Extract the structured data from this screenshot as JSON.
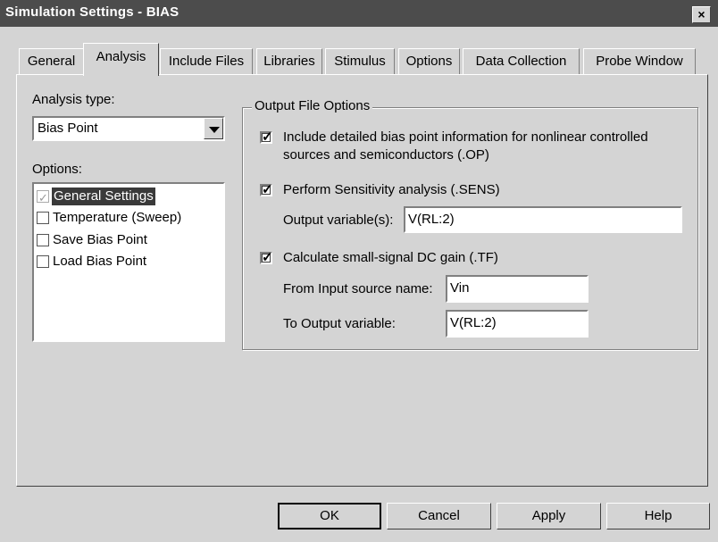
{
  "window": {
    "title": "Simulation Settings - BIAS",
    "close_glyph": "×"
  },
  "tabs": [
    {
      "label": "General"
    },
    {
      "label": "Analysis"
    },
    {
      "label": "Include Files"
    },
    {
      "label": "Libraries"
    },
    {
      "label": "Stimulus"
    },
    {
      "label": "Options"
    },
    {
      "label": "Data Collection"
    },
    {
      "label": "Probe Window"
    }
  ],
  "active_tab": "Analysis",
  "analysis_type": {
    "label": "Analysis type:",
    "value": "Bias Point"
  },
  "options": {
    "label": "Options:",
    "items": [
      {
        "label": "General Settings",
        "checked": true,
        "selected": true
      },
      {
        "label": "Temperature (Sweep)",
        "checked": false
      },
      {
        "label": "Save Bias Point",
        "checked": false
      },
      {
        "label": "Load Bias Point",
        "checked": false
      }
    ]
  },
  "output_file_options": {
    "title": "Output File Options",
    "include_detailed": {
      "line1": "Include detailed bias point information for nonlinear controlled",
      "line2": "sources and semiconductors (.OP)",
      "checked": true
    },
    "sensitivity": {
      "label": "Perform Sensitivity analysis (.SENS)",
      "checked": true,
      "output_label": "Output variable(s):",
      "output_value": "V(RL:2)"
    },
    "dc_gain": {
      "label": "Calculate small-signal DC gain (.TF)",
      "checked": true,
      "input_label": "From Input source name:",
      "input_value": "Vin",
      "output_label": "To Output variable:",
      "output_value": "V(RL:2)"
    }
  },
  "buttons": {
    "ok": "OK",
    "cancel": "Cancel",
    "apply": "Apply",
    "help": "Help"
  },
  "colors": {
    "titlebar": "#4c4c4c",
    "face": "#d4d4d4",
    "selection": "#3a3a3a"
  }
}
